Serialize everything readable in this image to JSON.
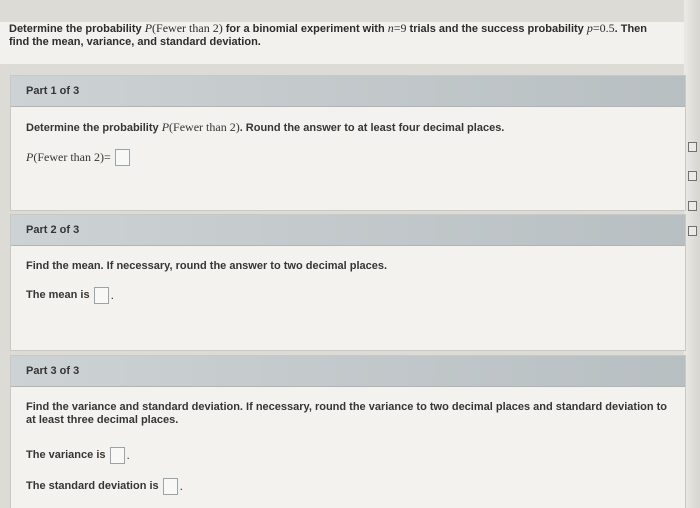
{
  "question": {
    "line1_prefix": "Determine the probability ",
    "line1_prob": "P",
    "line1_event": "(Fewer than 2)",
    "line1_middle": " for a binomial experiment with ",
    "n_symbol": "n",
    "n_value": "=9",
    "line1_end": " trials and the success probability ",
    "p_symbol": "p",
    "p_value": "=0.5",
    "line1_tail": ". Then",
    "line2": "find the mean, variance, and standard deviation."
  },
  "parts": [
    {
      "label": "Part 1 of 3",
      "instruction_prefix": "Determine the probability ",
      "instruction_prob": "P",
      "instruction_event": "(Fewer than 2)",
      "instruction_suffix": ". Round the answer to at least four decimal places.",
      "answer_prob": "P",
      "answer_event": "(Fewer than 2)",
      "answer_equals": "="
    },
    {
      "label": "Part 2 of 3",
      "instruction": "Find the mean. If necessary, round the answer to two decimal places.",
      "answer_label": "The mean is",
      "answer_suffix": "."
    },
    {
      "label": "Part 3 of 3",
      "instruction_line1": "Find the variance and standard deviation. If necessary, round the variance to two decimal places and standard deviation to",
      "instruction_line2": "at least three decimal places.",
      "variance_label": "The variance is",
      "variance_suffix": ".",
      "std_label": "The standard deviation is",
      "std_suffix": "."
    }
  ]
}
